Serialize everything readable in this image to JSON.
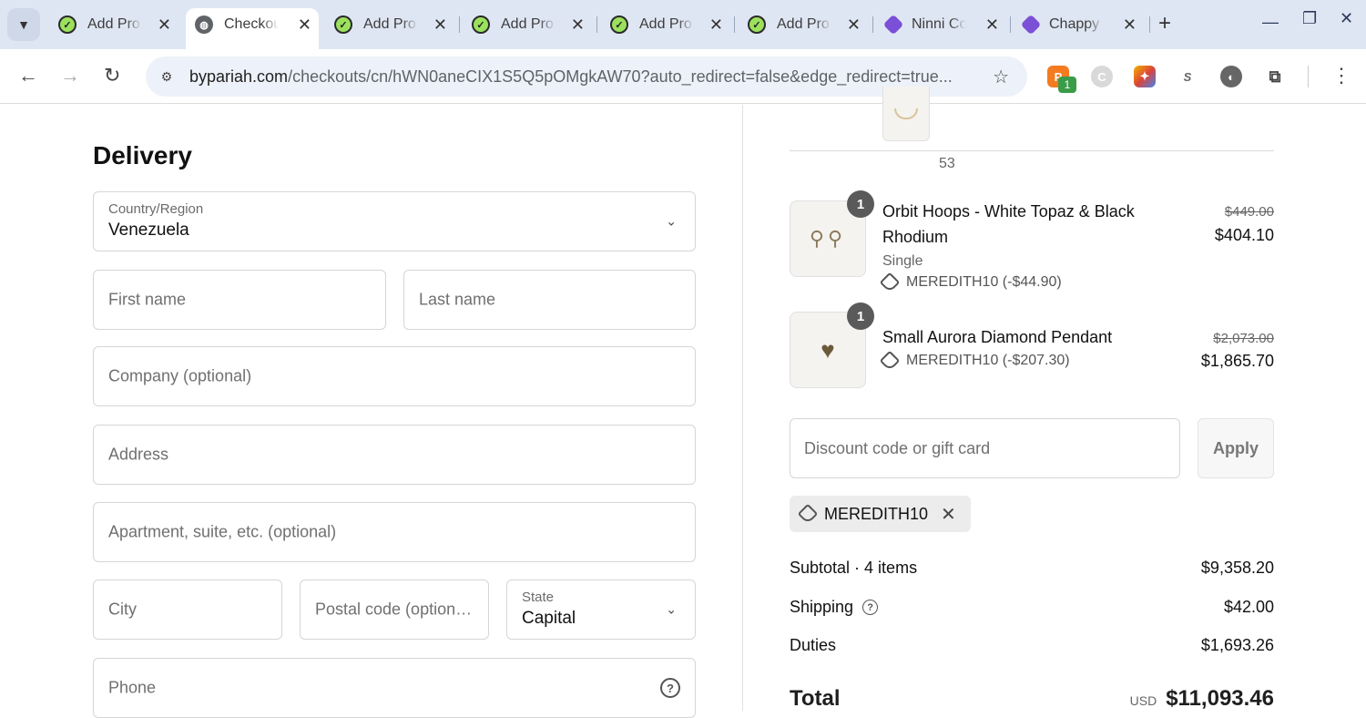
{
  "browser": {
    "tabs": [
      {
        "title": "Add Pro",
        "favicon": "green-check-icon",
        "active": false
      },
      {
        "title": "Checkout",
        "favicon": "globe-icon",
        "active": true
      },
      {
        "title": "Add Pro",
        "favicon": "green-check-icon",
        "active": false
      },
      {
        "title": "Add Pro",
        "favicon": "green-check-icon",
        "active": false
      },
      {
        "title": "Add Pro",
        "favicon": "green-check-icon",
        "active": false
      },
      {
        "title": "Add Pro",
        "favicon": "green-check-icon",
        "active": false
      },
      {
        "title": "Ninni Co",
        "favicon": "purple-gem-icon",
        "active": false
      },
      {
        "title": "Chappy",
        "favicon": "purple-gem-icon",
        "active": false
      }
    ],
    "url_domain": "bypariah.com",
    "url_rest": "/checkouts/cn/hWN0aneCIX1S5Q5pOMgkAW70?auto_redirect=false&edge_redirect=true...",
    "extension_badge": "1"
  },
  "delivery": {
    "heading": "Delivery",
    "country_label": "Country/Region",
    "country_value": "Venezuela",
    "first_name_ph": "First name",
    "last_name_ph": "Last name",
    "company_ph": "Company (optional)",
    "address_ph": "Address",
    "apartment_ph": "Apartment, suite, etc. (optional)",
    "city_ph": "City",
    "postal_ph": "Postal code (option…",
    "state_label": "State",
    "state_value": "Capital",
    "phone_ph": "Phone"
  },
  "summary": {
    "partial_item_variant": "53",
    "items": [
      {
        "qty": "1",
        "name": "Orbit Hoops - White Topaz & Black Rhodium",
        "variant": "Single",
        "discount": "MEREDITH10 (-$44.90)",
        "original": "$449.00",
        "price": "$404.10"
      },
      {
        "qty": "1",
        "name": "Small Aurora Diamond Pendant",
        "variant": "",
        "discount": "MEREDITH10 (-$207.30)",
        "original": "$2,073.00",
        "price": "$1,865.70"
      }
    ],
    "discount_ph": "Discount code or gift card",
    "apply_label": "Apply",
    "code_chip": "MEREDITH10",
    "subtotal_label": "Subtotal · 4 items",
    "subtotal_value": "$9,358.20",
    "shipping_label": "Shipping",
    "shipping_value": "$42.00",
    "duties_label": "Duties",
    "duties_value": "$1,693.26",
    "total_label": "Total",
    "total_currency": "USD",
    "total_value": "$11,093.46"
  }
}
